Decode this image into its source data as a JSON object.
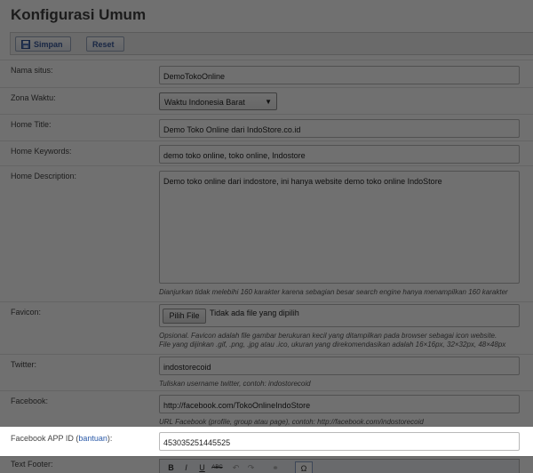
{
  "header": {
    "title": "Konfigurasi Umum"
  },
  "toolbar": {
    "save_label": "Simpan",
    "reset_label": "Reset"
  },
  "form": {
    "site_name": {
      "label": "Nama situs:",
      "value": "DemoTokoOnline"
    },
    "timezone": {
      "label": "Zona Waktu:",
      "value": "Waktu Indonesia Barat"
    },
    "home_title": {
      "label": "Home Title:",
      "value": "Demo Toko Online dari IndoStore.co.id"
    },
    "home_keywords": {
      "label": "Home Keywords:",
      "value": "demo toko online, toko online, Indostore"
    },
    "home_description": {
      "label": "Home Description:",
      "value": "Demo toko online dari indostore, ini hanya website demo toko online IndoStore",
      "hint": "Dianjurkan tidak melebihi 160 karakter karena sebagian besar search engine hanya menampilkan 160 karakter"
    },
    "favicon": {
      "label": "Favicon:",
      "button_label": "Pilih File",
      "file_status": "Tidak ada file yang dipilih",
      "hint_line1": "Opsional. Favicon adalah file gambar berukuran kecil yang ditampilkan pada browser sebagai icon website.",
      "hint_line2": "File yang dijinkan .gif, .png, .jpg atau .ico, ukuran yang direkomendasikan adalah 16×16px, 32×32px, 48×48px"
    },
    "twitter": {
      "label": "Twitter:",
      "value": "indostorecoid",
      "hint": "Tuliskan username twitter, contoh: indostorecoid"
    },
    "facebook": {
      "label": "Facebook:",
      "value": "http://facebook.com/TokoOnlineIndoStore",
      "hint": "URL Facebook (profile, group atau page), contoh: http://facebook.com/indostorecoid"
    },
    "facebook_app_id": {
      "label_prefix": "Facebook APP ID (",
      "help_link": "bantuan",
      "label_suffix": "):",
      "value": "453035251445525"
    },
    "text_footer": {
      "label": "Text Footer:"
    }
  },
  "editor_toolbar": {
    "bold": "B",
    "italic": "I",
    "underline": "U",
    "strike": "ABC",
    "undo": "↶",
    "redo": "↷",
    "special_char": "Ω"
  }
}
